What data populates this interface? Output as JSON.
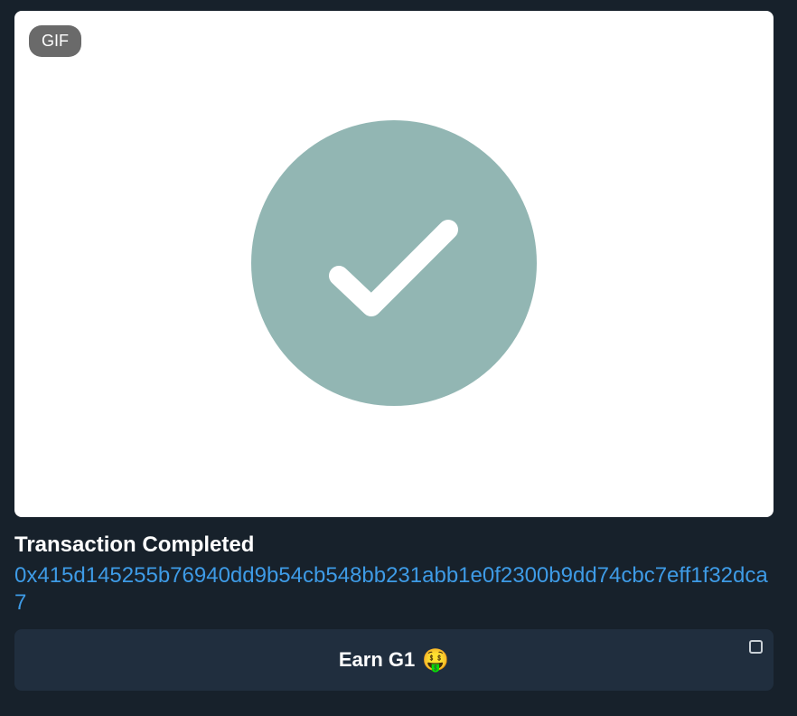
{
  "media": {
    "badge": "GIF",
    "icon": "check-circle-icon",
    "icon_color": "#92b6b3"
  },
  "caption": {
    "title": "Transaction Completed",
    "hash": "0x415d145255b76940dd9b54cb548bb231abb1e0f2300b9dd74cbc7eff1f32dca7"
  },
  "inline_button": {
    "label": "Earn G1",
    "emoji": "🤑",
    "corner_icon": "expand-icon"
  },
  "colors": {
    "background": "#17212b",
    "link": "#3e9be6",
    "button_bg": "#202e3e"
  }
}
